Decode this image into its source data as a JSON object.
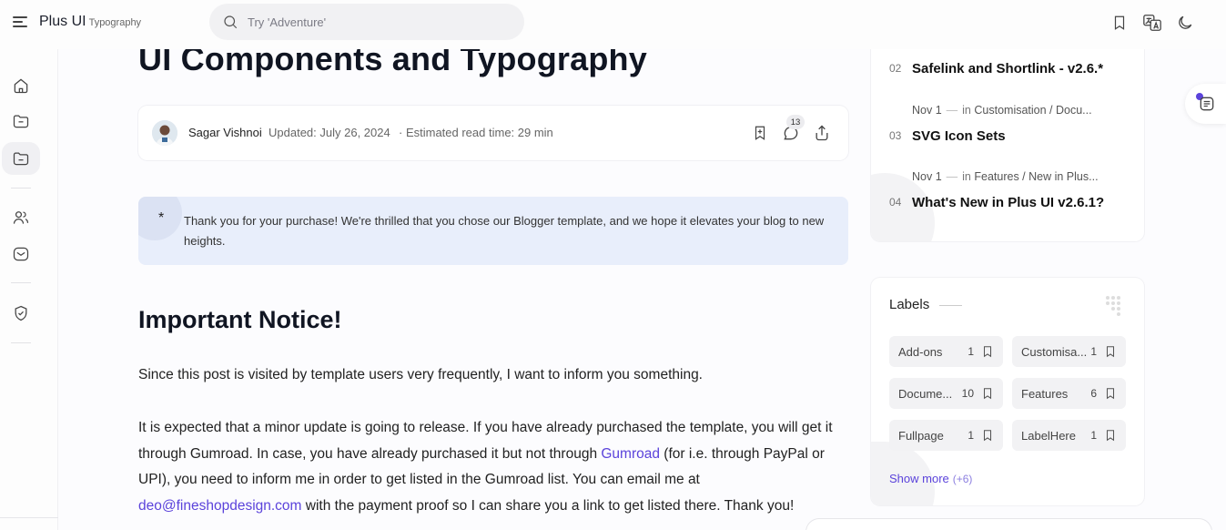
{
  "header": {
    "brand": "Plus UI",
    "brand_sub": "Typography",
    "search_placeholder": "Try 'Adventure'"
  },
  "post": {
    "title": "UI Components and Typography",
    "author": "Sagar Vishnoi",
    "updated": "Updated: July 26, 2024",
    "read_time": "· Estimated read time: 29 min",
    "comment_count": "13"
  },
  "note": {
    "symbol": "*",
    "text": "Thank you for your purchase! We're thrilled that you chose our Blogger template, and we hope it elevates your blog to new heights."
  },
  "content": {
    "heading": "Important Notice!",
    "paragraph1": "Since this post is visited by template users very frequently, I want to inform you something.",
    "p2_part1": "It is expected that a minor update is going to release. If you have already purchased the template, you will get it through Gumroad. In case, you have already purchased it but not through ",
    "p2_link": "Gumroad",
    "p2_part2": " (for i.e. through PayPal or UPI), you need to inform me in order to get listed in the Gumroad list. You can email me at ",
    "p2_email": "deo@fineshopdesign.com",
    "p2_part3": " with the payment proof so I can share you a link to get listed there. Thank you!"
  },
  "sidebar": {
    "posts": [
      {
        "num": "02",
        "title": "Safelink and Shortlink - v2.6.*"
      },
      {
        "num": "03",
        "title": "SVG Icon Sets",
        "date": "Nov 1",
        "in": "in",
        "category": "Customisation / Docu..."
      },
      {
        "num": "04",
        "title": "What's New in Plus UI v2.6.1?",
        "date": "Nov 1",
        "in": "in",
        "category": "Features / New in Plus..."
      }
    ],
    "labels_title": "Labels",
    "labels": [
      {
        "name": "Add-ons",
        "count": "1"
      },
      {
        "name": "Customisa...",
        "count": "1"
      },
      {
        "name": "Docume...",
        "count": "10"
      },
      {
        "name": "Features",
        "count": "6"
      },
      {
        "name": "Fullpage",
        "count": "1"
      },
      {
        "name": "LabelHere",
        "count": "1"
      }
    ],
    "show_more": "Show more",
    "show_more_count": "(+6)"
  },
  "colors": {
    "accent": "#5b43db",
    "note_bg": "#e8eefb",
    "page_bg": "#fcfcfe"
  }
}
